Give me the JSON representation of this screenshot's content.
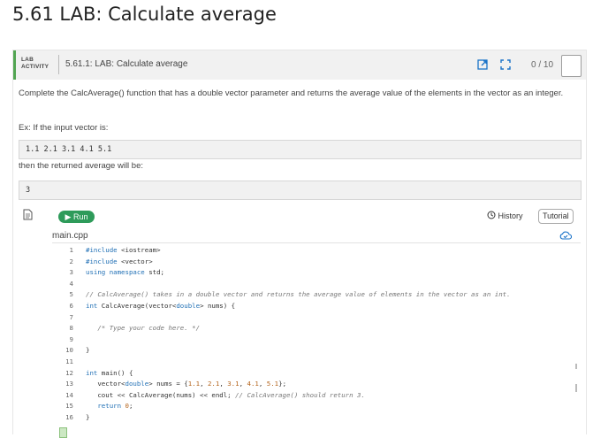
{
  "page": {
    "title": "5.61 LAB: Calculate average"
  },
  "lab": {
    "badge_line1": "LAB",
    "badge_line2": "ACTIVITY",
    "subtitle": "5.61.1: LAB: Calculate average",
    "score": "0 / 10",
    "accent_color": "#52a552"
  },
  "description": {
    "text": "Complete the CalcAverage() function that has a double vector parameter and returns the average value of the elements in the vector as an integer.",
    "example_intro": "Ex: If the input vector is:",
    "example_input": "1.1 2.1 3.1 4.1 5.1",
    "then_text": "then the returned average will be:",
    "example_output": "3"
  },
  "editor": {
    "run_label": "Run",
    "history_label": "History",
    "tutorial_label": "Tutorial",
    "filename": "main.cpp",
    "lines": [
      {
        "n": "1",
        "text": "#include <iostream>"
      },
      {
        "n": "2",
        "text": "#include <vector>"
      },
      {
        "n": "3",
        "text": "using namespace std;"
      },
      {
        "n": "4",
        "text": ""
      },
      {
        "n": "5",
        "text": "// CalcAverage() takes in a double vector and returns the average value of elements in the vector as an int."
      },
      {
        "n": "6",
        "text": "int CalcAverage(vector<double> nums) {"
      },
      {
        "n": "7",
        "text": ""
      },
      {
        "n": "8",
        "text": "   /* Type your code here. */"
      },
      {
        "n": "9",
        "text": ""
      },
      {
        "n": "10",
        "text": "}"
      },
      {
        "n": "11",
        "text": ""
      },
      {
        "n": "12",
        "text": "int main() {"
      },
      {
        "n": "13",
        "text": "   vector<double> nums = {1.1, 2.1, 3.1, 4.1, 5.1};"
      },
      {
        "n": "14",
        "text": "   cout << CalcAverage(nums) << endl; // CalcAverage() should return 3."
      },
      {
        "n": "15",
        "text": "   return 0;"
      },
      {
        "n": "16",
        "text": "}"
      }
    ]
  },
  "colors": {
    "run_button": "#2e9b5a",
    "keyword": "#1f6fb5",
    "comment": "#777777"
  }
}
